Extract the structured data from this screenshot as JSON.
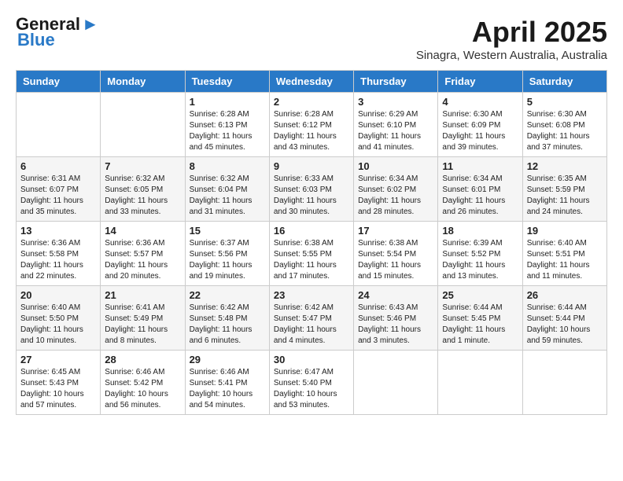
{
  "header": {
    "logo_line1": "General",
    "logo_line2": "Blue",
    "month": "April 2025",
    "location": "Sinagra, Western Australia, Australia"
  },
  "days_of_week": [
    "Sunday",
    "Monday",
    "Tuesday",
    "Wednesday",
    "Thursday",
    "Friday",
    "Saturday"
  ],
  "weeks": [
    [
      {
        "day": "",
        "info": ""
      },
      {
        "day": "",
        "info": ""
      },
      {
        "day": "1",
        "info": "Sunrise: 6:28 AM\nSunset: 6:13 PM\nDaylight: 11 hours and 45 minutes."
      },
      {
        "day": "2",
        "info": "Sunrise: 6:28 AM\nSunset: 6:12 PM\nDaylight: 11 hours and 43 minutes."
      },
      {
        "day": "3",
        "info": "Sunrise: 6:29 AM\nSunset: 6:10 PM\nDaylight: 11 hours and 41 minutes."
      },
      {
        "day": "4",
        "info": "Sunrise: 6:30 AM\nSunset: 6:09 PM\nDaylight: 11 hours and 39 minutes."
      },
      {
        "day": "5",
        "info": "Sunrise: 6:30 AM\nSunset: 6:08 PM\nDaylight: 11 hours and 37 minutes."
      }
    ],
    [
      {
        "day": "6",
        "info": "Sunrise: 6:31 AM\nSunset: 6:07 PM\nDaylight: 11 hours and 35 minutes."
      },
      {
        "day": "7",
        "info": "Sunrise: 6:32 AM\nSunset: 6:05 PM\nDaylight: 11 hours and 33 minutes."
      },
      {
        "day": "8",
        "info": "Sunrise: 6:32 AM\nSunset: 6:04 PM\nDaylight: 11 hours and 31 minutes."
      },
      {
        "day": "9",
        "info": "Sunrise: 6:33 AM\nSunset: 6:03 PM\nDaylight: 11 hours and 30 minutes."
      },
      {
        "day": "10",
        "info": "Sunrise: 6:34 AM\nSunset: 6:02 PM\nDaylight: 11 hours and 28 minutes."
      },
      {
        "day": "11",
        "info": "Sunrise: 6:34 AM\nSunset: 6:01 PM\nDaylight: 11 hours and 26 minutes."
      },
      {
        "day": "12",
        "info": "Sunrise: 6:35 AM\nSunset: 5:59 PM\nDaylight: 11 hours and 24 minutes."
      }
    ],
    [
      {
        "day": "13",
        "info": "Sunrise: 6:36 AM\nSunset: 5:58 PM\nDaylight: 11 hours and 22 minutes."
      },
      {
        "day": "14",
        "info": "Sunrise: 6:36 AM\nSunset: 5:57 PM\nDaylight: 11 hours and 20 minutes."
      },
      {
        "day": "15",
        "info": "Sunrise: 6:37 AM\nSunset: 5:56 PM\nDaylight: 11 hours and 19 minutes."
      },
      {
        "day": "16",
        "info": "Sunrise: 6:38 AM\nSunset: 5:55 PM\nDaylight: 11 hours and 17 minutes."
      },
      {
        "day": "17",
        "info": "Sunrise: 6:38 AM\nSunset: 5:54 PM\nDaylight: 11 hours and 15 minutes."
      },
      {
        "day": "18",
        "info": "Sunrise: 6:39 AM\nSunset: 5:52 PM\nDaylight: 11 hours and 13 minutes."
      },
      {
        "day": "19",
        "info": "Sunrise: 6:40 AM\nSunset: 5:51 PM\nDaylight: 11 hours and 11 minutes."
      }
    ],
    [
      {
        "day": "20",
        "info": "Sunrise: 6:40 AM\nSunset: 5:50 PM\nDaylight: 11 hours and 10 minutes."
      },
      {
        "day": "21",
        "info": "Sunrise: 6:41 AM\nSunset: 5:49 PM\nDaylight: 11 hours and 8 minutes."
      },
      {
        "day": "22",
        "info": "Sunrise: 6:42 AM\nSunset: 5:48 PM\nDaylight: 11 hours and 6 minutes."
      },
      {
        "day": "23",
        "info": "Sunrise: 6:42 AM\nSunset: 5:47 PM\nDaylight: 11 hours and 4 minutes."
      },
      {
        "day": "24",
        "info": "Sunrise: 6:43 AM\nSunset: 5:46 PM\nDaylight: 11 hours and 3 minutes."
      },
      {
        "day": "25",
        "info": "Sunrise: 6:44 AM\nSunset: 5:45 PM\nDaylight: 11 hours and 1 minute."
      },
      {
        "day": "26",
        "info": "Sunrise: 6:44 AM\nSunset: 5:44 PM\nDaylight: 10 hours and 59 minutes."
      }
    ],
    [
      {
        "day": "27",
        "info": "Sunrise: 6:45 AM\nSunset: 5:43 PM\nDaylight: 10 hours and 57 minutes."
      },
      {
        "day": "28",
        "info": "Sunrise: 6:46 AM\nSunset: 5:42 PM\nDaylight: 10 hours and 56 minutes."
      },
      {
        "day": "29",
        "info": "Sunrise: 6:46 AM\nSunset: 5:41 PM\nDaylight: 10 hours and 54 minutes."
      },
      {
        "day": "30",
        "info": "Sunrise: 6:47 AM\nSunset: 5:40 PM\nDaylight: 10 hours and 53 minutes."
      },
      {
        "day": "",
        "info": ""
      },
      {
        "day": "",
        "info": ""
      },
      {
        "day": "",
        "info": ""
      }
    ]
  ]
}
